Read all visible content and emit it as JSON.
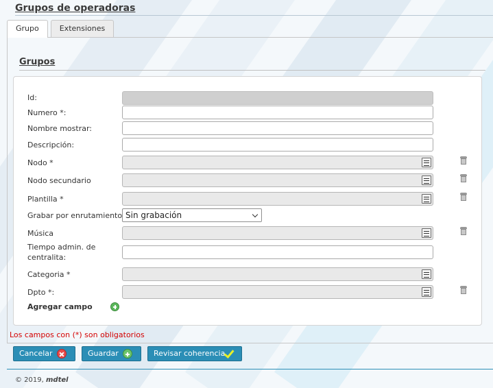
{
  "page": {
    "title": "Grupos de operadoras"
  },
  "tabs": [
    {
      "label": "Grupo",
      "active": true
    },
    {
      "label": "Extensiones",
      "active": false
    }
  ],
  "section": {
    "title": "Grupos"
  },
  "form": {
    "fields": [
      {
        "label": "Id:",
        "value": "",
        "kind": "readonly"
      },
      {
        "label": "Numero *:",
        "value": "",
        "kind": "text"
      },
      {
        "label": "Nombre mostrar:",
        "value": "",
        "kind": "text"
      },
      {
        "label": "Descripción:",
        "value": "",
        "kind": "text"
      },
      {
        "label": "Nodo *",
        "value": "",
        "kind": "lookup"
      },
      {
        "label": "Nodo secundario",
        "value": "",
        "kind": "lookup"
      },
      {
        "label": "Plantilla *",
        "value": "",
        "kind": "lookup"
      },
      {
        "label": "Grabar por enrutamiento:",
        "value": "Sin grabación",
        "kind": "select"
      },
      {
        "label": "Música",
        "value": "",
        "kind": "lookup"
      },
      {
        "label": "Tiempo admin. de centralita:",
        "value": "",
        "kind": "text"
      },
      {
        "label": "Categoria *",
        "value": "",
        "kind": "lookup"
      },
      {
        "label": "Dpto *:",
        "value": "",
        "kind": "lookup"
      }
    ],
    "add_field_label": "Agregar campo"
  },
  "required_note": "Los campos con (*) son obligatorios",
  "buttons": {
    "cancel": "Cancelar",
    "save": "Guardar",
    "check": "Revisar coherencia"
  },
  "footer": {
    "copyright": "© 2019,",
    "brand": "mdtel"
  },
  "colors": {
    "button": "#2b8eb6",
    "required": "#d40000"
  },
  "icons": {
    "lookup": "list-icon",
    "delete": "trash-icon",
    "add": "add-circle-icon",
    "cancel": "cancel-icon",
    "save": "save-plus-icon",
    "check": "check-icon"
  }
}
